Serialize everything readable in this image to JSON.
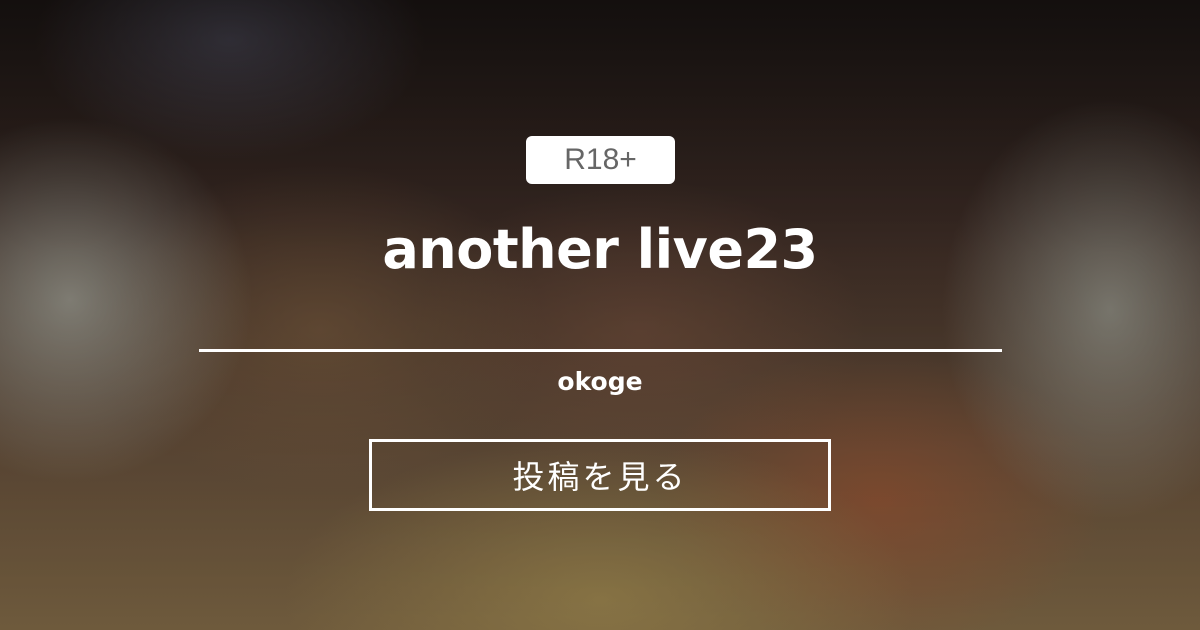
{
  "post": {
    "rating": "R18+",
    "title": "another live23",
    "author": "okoge",
    "view_label": "投稿を見る"
  },
  "colors": {
    "text": "#ffffff",
    "badge_background": "#ffffff",
    "badge_text": "#666666"
  }
}
